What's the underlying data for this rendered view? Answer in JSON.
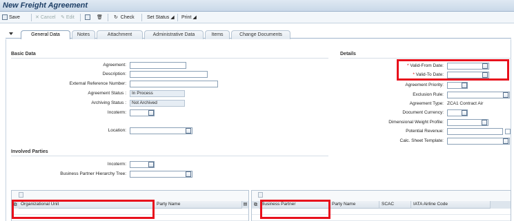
{
  "window": {
    "title": "New Freight Agreement"
  },
  "toolbar": {
    "save": "Save",
    "cancel": "Cancel",
    "edit": "Edit",
    "check": "Check",
    "set_status": "Set Status",
    "print": "Print"
  },
  "tabs": [
    "General Data",
    "Notes",
    "Attachment",
    "Administrative Data",
    "Items",
    "Change Documents"
  ],
  "basic_data": {
    "heading": "Basic Data",
    "agreement_label": "Agreement:",
    "description_label": "Description:",
    "ext_ref_label": "External Reference Number:",
    "status_label": "Agreement Status :",
    "status_value": "In Process",
    "archiving_label": "Archiving Status :",
    "archiving_value": "Not Archived",
    "incoterm_label": "Incoterm:",
    "location_label": "Location:"
  },
  "details": {
    "heading": "Details",
    "valid_from_label": "Valid-From Date:",
    "valid_to_label": "Valid-To Date:",
    "priority_label": "Agreement Priority:",
    "exclusion_label": "Exclusion Rule:",
    "type_label": "Agreement Type:",
    "type_value": "ZCA1  Contract Air",
    "currency_label": "Document Currency:",
    "dim_weight_label": "Dimensional Weight Profile:",
    "revenue_label": "Potential Revenue:",
    "calc_sheet_label": "Calc. Sheet Template:"
  },
  "involved_parties": {
    "heading": "Involved Parties",
    "incoterm_label": "Incoterm:",
    "bp_tree_label": "Business Partner Hierarchy Tree:"
  },
  "left_table": {
    "columns": [
      "Organizational Unit",
      "Party Name"
    ]
  },
  "right_table": {
    "columns": [
      "Business Partner",
      "Party Name",
      "SCAC",
      "IATA Airline Code"
    ]
  },
  "colors": {
    "highlight": "#e8101c",
    "title": "#1e3f66"
  }
}
